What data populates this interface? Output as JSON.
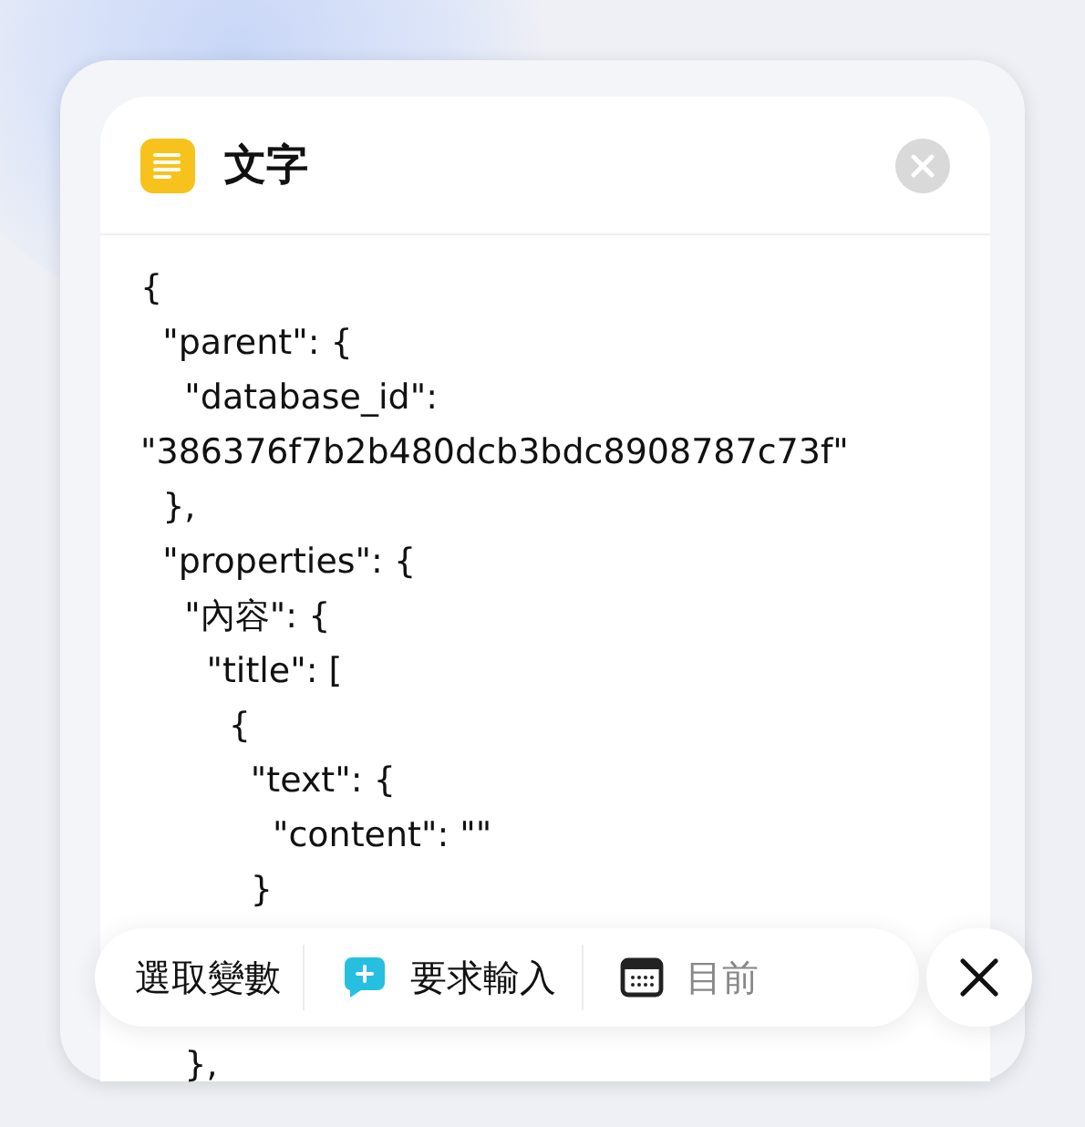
{
  "card": {
    "title": "文字"
  },
  "code_lines": [
    "{",
    "  \"parent\": {",
    "    \"database_id\":",
    "\"386376f7b2b480dcb3bdc8908787c73f\"",
    "  },",
    "  \"properties\": {",
    "    \"內容\": {",
    "      \"title\": [",
    "        {",
    "          \"text\": {",
    "            \"content\": \"\"",
    "          }",
    "    },"
  ],
  "toolbar": {
    "items": [
      {
        "kind": "text",
        "label": "選取變數"
      },
      {
        "kind": "ask",
        "label": "要求輸入"
      },
      {
        "kind": "date",
        "label": "目前"
      }
    ]
  }
}
